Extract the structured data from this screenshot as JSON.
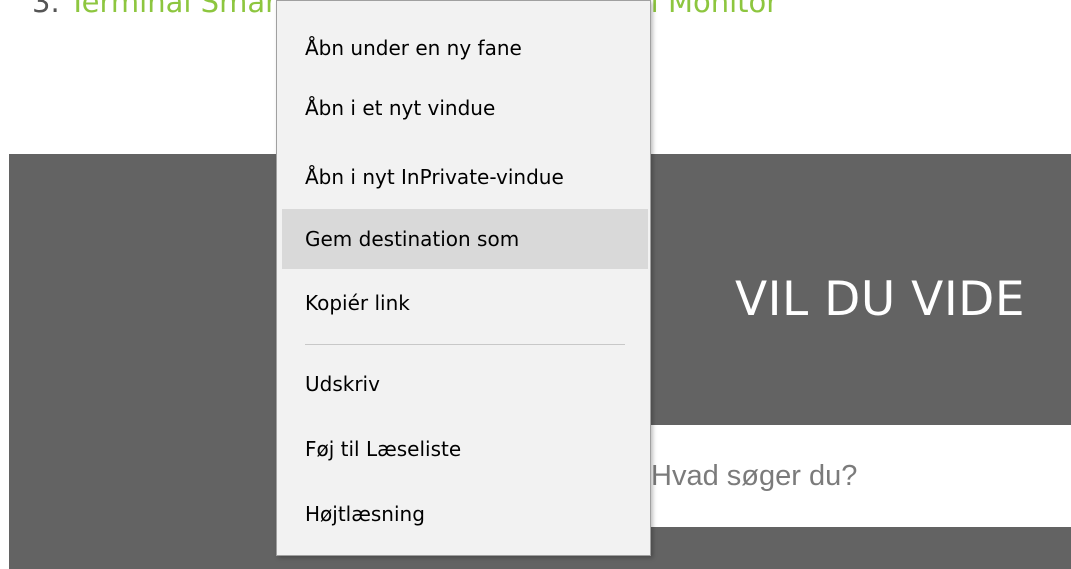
{
  "breadcrumb": {
    "prefix": "3.",
    "first": "Terminal Smart Monitor",
    "separator": "/",
    "second": "Terminal Multi Monitor"
  },
  "banner": {
    "headline": "VIL DU VIDE",
    "search_placeholder": "Hvad søger du?"
  },
  "context_menu": {
    "items": [
      {
        "label": "Åbn under en ny fane"
      },
      {
        "label": "Åbn i et nyt vindue"
      },
      {
        "label": "Åbn i nyt InPrivate-vindue"
      },
      {
        "label": "Gem destination som"
      },
      {
        "label": "Kopiér link"
      },
      {
        "label": "Udskriv"
      },
      {
        "label": "Føj til Læseliste"
      },
      {
        "label": "Højtlæsning"
      }
    ]
  },
  "colors": {
    "link": "#8dc63f",
    "banner_bg": "#636363",
    "menu_bg": "#f2f2f2",
    "menu_hover": "#d9d9d9"
  }
}
